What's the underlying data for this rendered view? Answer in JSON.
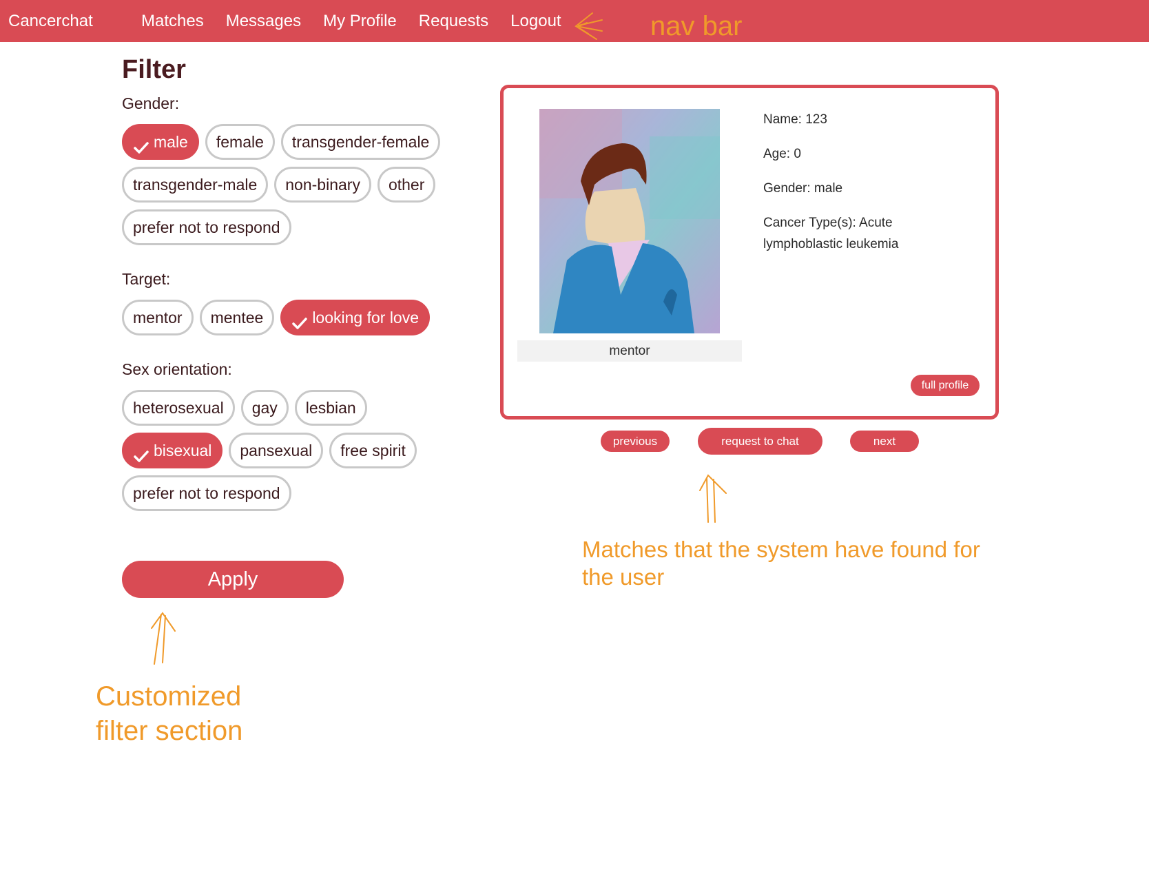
{
  "nav": {
    "brand": "Cancerchat",
    "links": [
      "Matches",
      "Messages",
      "My Profile",
      "Requests",
      "Logout"
    ]
  },
  "annotations": {
    "nav_bar": "nav bar",
    "matches_line1": "Matches that the system have found for",
    "matches_line2": "the user",
    "filter_line1": "Customized",
    "filter_line2": "filter section"
  },
  "filter": {
    "title": "Filter",
    "gender": {
      "label": "Gender:",
      "options": [
        "male",
        "female",
        "transgender-female",
        "transgender-male",
        "non-binary",
        "other",
        "prefer not to respond"
      ],
      "selected": [
        "male"
      ]
    },
    "target": {
      "label": "Target:",
      "options": [
        "mentor",
        "mentee",
        "looking for love"
      ],
      "selected": [
        "looking for love"
      ]
    },
    "orientation": {
      "label": "Sex orientation:",
      "options": [
        "heterosexual",
        "gay",
        "lesbian",
        "bisexual",
        "pansexual",
        "free spirit",
        "prefer not to respond"
      ],
      "selected": [
        "bisexual"
      ]
    },
    "apply_label": "Apply"
  },
  "match": {
    "role": "mentor",
    "name": "Name: 123",
    "age": "Age: 0",
    "gender": "Gender: male",
    "cancer_types": "Cancer Type(s): Acute lymphoblastic leukemia",
    "full_profile_label": "full profile"
  },
  "controls": {
    "previous_label": "previous",
    "request_label": "request to chat",
    "next_label": "next"
  },
  "colors": {
    "accent": "#d94b54",
    "annotation": "#f09a2a"
  },
  "icons": [
    "check-icon",
    "hand-drawn-arrow-icon",
    "profile-avatar"
  ]
}
